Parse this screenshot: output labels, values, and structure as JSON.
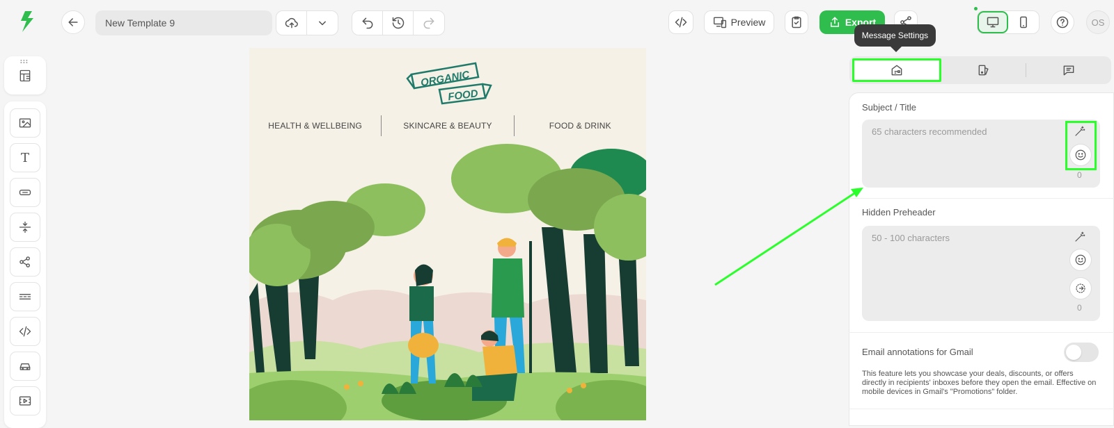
{
  "header": {
    "template_name": "New Template 9",
    "preview_label": "Preview",
    "export_label": "Export",
    "avatar_initials": "OS"
  },
  "tooltip": {
    "text": "Message Settings"
  },
  "canvas": {
    "brand_line1": "ORGANIC",
    "brand_line2": "FOOD",
    "nav": [
      "HEALTH & WELLBEING",
      "SKINCARE & BEAUTY",
      "FOOD & DRINK"
    ]
  },
  "settings": {
    "subject": {
      "label": "Subject / Title",
      "placeholder": "65 characters recommended",
      "count": "0"
    },
    "preheader": {
      "label": "Hidden Preheader",
      "placeholder": "50 - 100 characters",
      "count": "0"
    },
    "gmail": {
      "label": "Email annotations for Gmail",
      "description": "This feature lets you showcase your deals, discounts, or offers directly in recipients' inboxes before they open the email. Effective on mobile devices in Gmail's \"Promotions\" folder.",
      "enabled": false
    }
  },
  "colors": {
    "accent": "#2fbd4e",
    "highlight": "#2bff2b",
    "brand_teal": "#1f7a6a"
  }
}
